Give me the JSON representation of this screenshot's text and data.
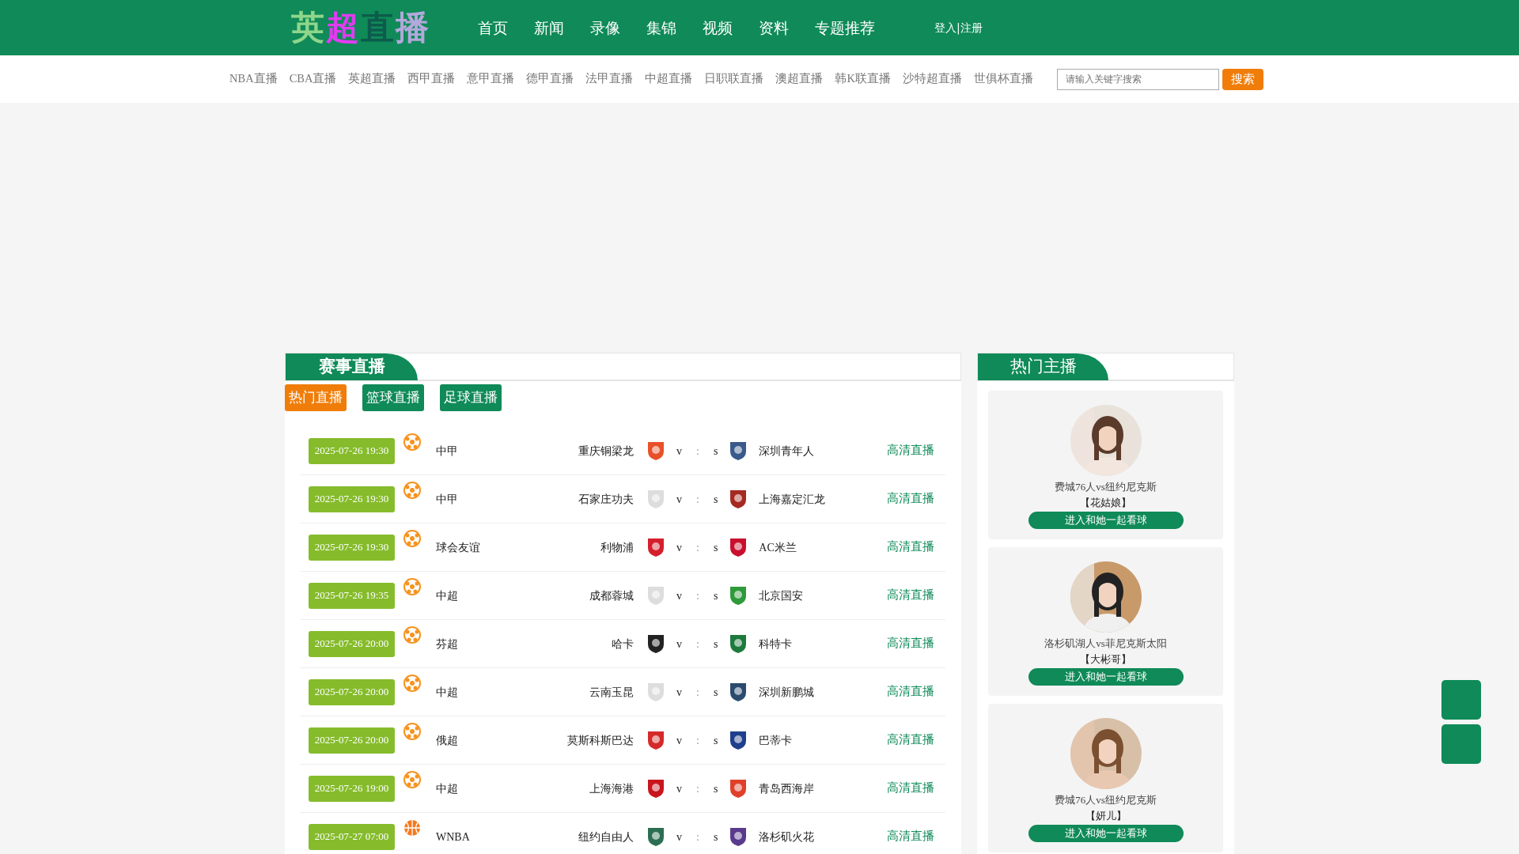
{
  "logo": [
    {
      "text": "英",
      "color": "#8fd68a"
    },
    {
      "text": "超",
      "color": "#e03cf0"
    },
    {
      "text": "直",
      "color": "#0c5b4c"
    },
    {
      "text": "播",
      "color": "#b3a8dc"
    }
  ],
  "main_nav": [
    "首页",
    "新闻",
    "录像",
    "集锦",
    "视频",
    "资料",
    "专题推荐"
  ],
  "login": "登入|注册",
  "sub_nav": [
    "NBA直播",
    "CBA直播",
    "英超直播",
    "西甲直播",
    "意甲直播",
    "德甲直播",
    "法甲直播",
    "中超直播",
    "日职联直播",
    "澳超直播",
    "韩K联直播",
    "沙特超直播",
    "世俱杯直播"
  ],
  "search": {
    "placeholder": "请输入关键字搜索",
    "button": "搜索"
  },
  "matches_panel": {
    "title": "赛事直播",
    "filters": [
      {
        "label": "热门直播",
        "selected": true
      },
      {
        "label": "篮球直播",
        "selected": false
      },
      {
        "label": "足球直播",
        "selected": false
      }
    ],
    "rows": [
      {
        "time": "2025-07-26 19:30",
        "kind": "football",
        "league": "中甲",
        "home": {
          "name": "重庆铜梁龙",
          "color": "#e8502a"
        },
        "v": "v",
        "sep": ":",
        "s": "s",
        "away": {
          "name": "深圳青年人",
          "color": "#3a5a8c"
        },
        "link": "高清直播"
      },
      {
        "time": "2025-07-26 19:30",
        "kind": "football",
        "league": "中甲",
        "home": {
          "name": "石家庄功夫",
          "color": "#dddddd"
        },
        "v": "v",
        "sep": ":",
        "s": "s",
        "away": {
          "name": "上海嘉定汇龙",
          "color": "#a52a22"
        },
        "link": "高清直播"
      },
      {
        "time": "2025-07-26 19:30",
        "kind": "football",
        "league": "球会友谊",
        "home": {
          "name": "利物浦",
          "color": "#d4202c"
        },
        "v": "v",
        "sep": ":",
        "s": "s",
        "away": {
          "name": "AC米兰",
          "color": "#c8102e"
        },
        "link": "高清直播"
      },
      {
        "time": "2025-07-26 19:35",
        "kind": "football",
        "league": "中超",
        "home": {
          "name": "成都蓉城",
          "color": "#dddddd"
        },
        "v": "v",
        "sep": ":",
        "s": "s",
        "away": {
          "name": "北京国安",
          "color": "#2e9a3a"
        },
        "link": "高清直播"
      },
      {
        "time": "2025-07-26 20:00",
        "kind": "football",
        "league": "芬超",
        "home": {
          "name": "哈卡",
          "color": "#222222"
        },
        "v": "v",
        "sep": ":",
        "s": "s",
        "away": {
          "name": "科特卡",
          "color": "#1e7a3c"
        },
        "link": "高清直播"
      },
      {
        "time": "2025-07-26 20:00",
        "kind": "football",
        "league": "中超",
        "home": {
          "name": "云南玉昆",
          "color": "#dddddd"
        },
        "v": "v",
        "sep": ":",
        "s": "s",
        "away": {
          "name": "深圳新鹏城",
          "color": "#2a4a6e"
        },
        "link": "高清直播"
      },
      {
        "time": "2025-07-26 20:00",
        "kind": "football",
        "league": "俄超",
        "home": {
          "name": "莫斯科斯巴达",
          "color": "#d42a2a"
        },
        "v": "v",
        "sep": ":",
        "s": "s",
        "away": {
          "name": "巴蒂卡",
          "color": "#1f3f8c"
        },
        "link": "高清直播"
      },
      {
        "time": "2025-07-26 19:00",
        "kind": "football",
        "league": "中超",
        "home": {
          "name": "上海海港",
          "color": "#c8161e"
        },
        "v": "v",
        "sep": ":",
        "s": "s",
        "away": {
          "name": "青岛西海岸",
          "color": "#e0402a"
        },
        "link": "高清直播"
      },
      {
        "time": "2025-07-27 07:00",
        "kind": "basketball",
        "league": "WNBA",
        "home": {
          "name": "纽约自由人",
          "color": "#2b6e54"
        },
        "v": "v",
        "sep": ":",
        "s": "s",
        "away": {
          "name": "洛杉矶火花",
          "color": "#5a3a8c"
        },
        "link": "高清直播"
      }
    ]
  },
  "anchors_panel": {
    "title": "热门主播",
    "cards": [
      {
        "match": "费城76人vs纽约尼克斯",
        "anchor": "【花姑娘】",
        "button": "进入和她一起看球"
      },
      {
        "match": "洛杉矶湖人vs菲尼克斯太阳",
        "anchor": "【大彬哥】",
        "button": "进入和她一起看球"
      },
      {
        "match": "费城76人vs纽约尼克斯",
        "anchor": "【妍儿】",
        "button": "进入和她一起看球"
      }
    ]
  }
}
